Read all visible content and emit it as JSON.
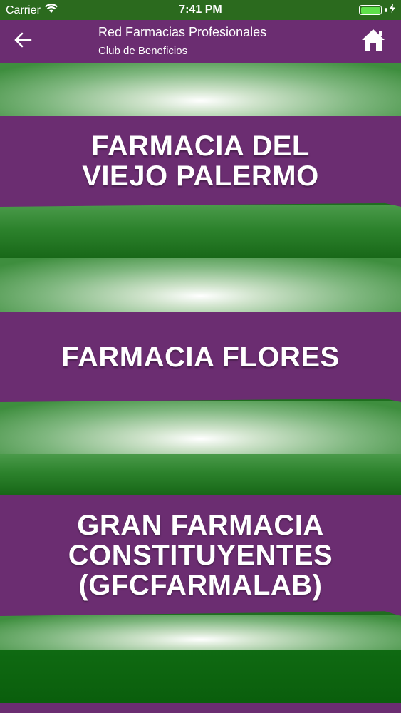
{
  "status_bar": {
    "carrier": "Carrier",
    "time": "7:41 PM",
    "battery_color": "#5ee04a"
  },
  "nav": {
    "title": "Red Farmacias Profesionales",
    "subtitle": "Club de Beneficios",
    "back_icon": "arrow-left-icon",
    "home_icon": "home-icon",
    "background": "#6b2d71"
  },
  "pharmacies": [
    {
      "line1": "FARMACIA DEL",
      "line2": "VIEJO PALERMO",
      "line3": ""
    },
    {
      "line1": "FARMACIA FLORES",
      "line2": "",
      "line3": ""
    },
    {
      "line1": "GRAN FARMACIA",
      "line2": "CONSTITUYENTES",
      "line3": "(GFCFARMALAB)"
    }
  ],
  "colors": {
    "card_purple": "#6b2d71",
    "green_dark": "#176617",
    "green_light": "#cfe3cb"
  }
}
